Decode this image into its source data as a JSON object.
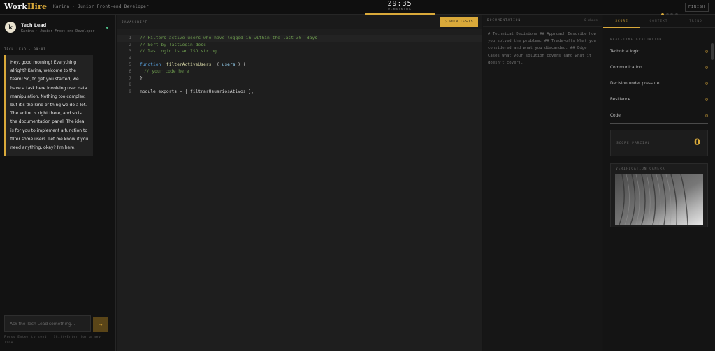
{
  "header": {
    "logo_main": "Work",
    "logo_accent": "Hire",
    "session": "Karina · Junior Front-end Developer",
    "timer": "29:35",
    "timer_label": "REMAINING",
    "finish_label": "FINISH"
  },
  "chat": {
    "name": "Tech Lead",
    "avatar_letter": "k",
    "subtitle": "Karina · Junior Front-end Developer",
    "message_meta": "TECH LEAD · 09:01",
    "message": "Hey, good morning! Everything alright? Karina, welcome to the team! So, to get you started, we have a task here involving user data manipulation. Nothing too complex, but it's the kind of thing we do a lot. The editor is right there, and so is the documentation panel. The idea is for you to implement a function to filter some users. Let me know if you need anything, okay? I'm here.",
    "input_placeholder": "Ask the Tech Lead something...",
    "send_icon": "→",
    "hint": "Press Enter to send · Shift+Enter for a new line"
  },
  "editor": {
    "language": "JAVASCRIPT",
    "run_label": "▷ RUN TESTS",
    "lines": [
      {
        "n": "1",
        "parts": [
          [
            "cm",
            "// Filters active users who have logged in within the last 30  days"
          ]
        ]
      },
      {
        "n": "2",
        "parts": [
          [
            "cm",
            "// Sort by lastLogin desc"
          ]
        ]
      },
      {
        "n": "3",
        "parts": [
          [
            "cm",
            "// lastLogin is an ISO string"
          ]
        ]
      },
      {
        "n": "4",
        "parts": []
      },
      {
        "n": "5",
        "parts": [
          [
            "kw",
            "function "
          ],
          [
            "fn",
            " filterActiveUsers "
          ],
          [
            "pn",
            " ( "
          ],
          [
            "pm",
            "users"
          ],
          [
            "pn",
            " ) {"
          ]
        ]
      },
      {
        "n": "6",
        "parts": [
          [
            "guide",
            "// your code here"
          ]
        ]
      },
      {
        "n": "7",
        "parts": [
          [
            "pn",
            "}"
          ]
        ]
      },
      {
        "n": "8",
        "parts": []
      },
      {
        "n": "9",
        "parts": [
          [
            "pn",
            "module.exports = { filtrarUsuariosAtivos };"
          ]
        ]
      }
    ]
  },
  "docs": {
    "title": "DOCUMENTATION",
    "count": "0 chars",
    "placeholder": "# Technical Decisions ## Approach Describe how you solved the problem. ## Trade-offs What you considered and what you discarded. ## Edge Cases What your solution covers (and what it doesn't cover)."
  },
  "right": {
    "tabs": [
      "SCORE",
      "CONTEXT",
      "TREND"
    ],
    "active_tab": 0,
    "realtime_title": "REAL-TIME EVALUATION",
    "metrics": [
      {
        "label": "Technical logic",
        "value": "0"
      },
      {
        "label": "Communication",
        "value": "0"
      },
      {
        "label": "Decision under pressure",
        "value": "0"
      },
      {
        "label": "Resilience",
        "value": "0"
      },
      {
        "label": "Code",
        "value": "0"
      }
    ],
    "partial_label": "SCORE PARCIAL",
    "partial_value": "0",
    "camera_label": "VERIFICATION CAMERA"
  },
  "colors": {
    "accent": "#d9a93a",
    "online": "#4fbf8a"
  }
}
